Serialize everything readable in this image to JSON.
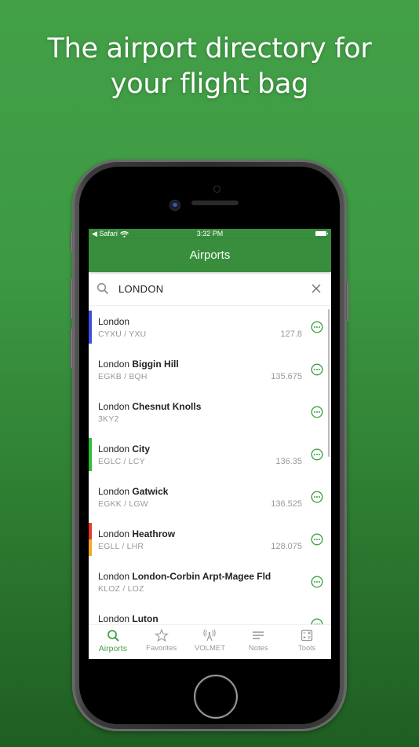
{
  "headline": {
    "line1": "The airport directory for",
    "line2": "your flight bag"
  },
  "status_bar": {
    "back_label": "◀ Safari",
    "time": "3:32 PM",
    "wifi_icon": "wifi-icon",
    "battery_icon": "battery-icon"
  },
  "nav": {
    "title": "Airports"
  },
  "search": {
    "value": "LONDON",
    "icon": "search-icon",
    "clear_icon": "close-icon"
  },
  "colors": {
    "brand_green": "#388e3c",
    "accent_green": "#43a047",
    "marker_blue": "#3f51e0",
    "marker_green": "#2ebd3a",
    "marker_red": "#e53935",
    "marker_orange": "#f5a623"
  },
  "airports": [
    {
      "city": "London",
      "name": "",
      "codes": "CYXU / YXU",
      "freq": "127.8",
      "marker": [
        "blue"
      ]
    },
    {
      "city": "London",
      "name": "Biggin Hill",
      "codes": "EGKB / BQH",
      "freq": "135.675",
      "marker": []
    },
    {
      "city": "London",
      "name": "Chesnut Knolls",
      "codes": "3KY2",
      "freq": "",
      "marker": []
    },
    {
      "city": "London",
      "name": "City",
      "codes": "EGLC / LCY",
      "freq": "136.35",
      "marker": [
        "green"
      ]
    },
    {
      "city": "London",
      "name": "Gatwick",
      "codes": "EGKK / LGW",
      "freq": "136.525",
      "marker": []
    },
    {
      "city": "London",
      "name": "Heathrow",
      "codes": "EGLL / LHR",
      "freq": "128.075",
      "marker": [
        "red",
        "orange"
      ]
    },
    {
      "city": "London",
      "name": "London-Corbin Arpt-Magee Fld",
      "codes": "KLOZ / LOZ",
      "freq": "",
      "marker": []
    },
    {
      "city": "London",
      "name": "Luton",
      "codes": "",
      "freq": "",
      "marker": []
    }
  ],
  "tabs": [
    {
      "label": "Airports",
      "icon": "search-icon",
      "active": true
    },
    {
      "label": "Favorites",
      "icon": "star-icon",
      "active": false
    },
    {
      "label": "VOLMET",
      "icon": "antenna-icon",
      "active": false
    },
    {
      "label": "Notes",
      "icon": "notes-icon",
      "active": false
    },
    {
      "label": "Tools",
      "icon": "calculator-icon",
      "active": false
    }
  ]
}
